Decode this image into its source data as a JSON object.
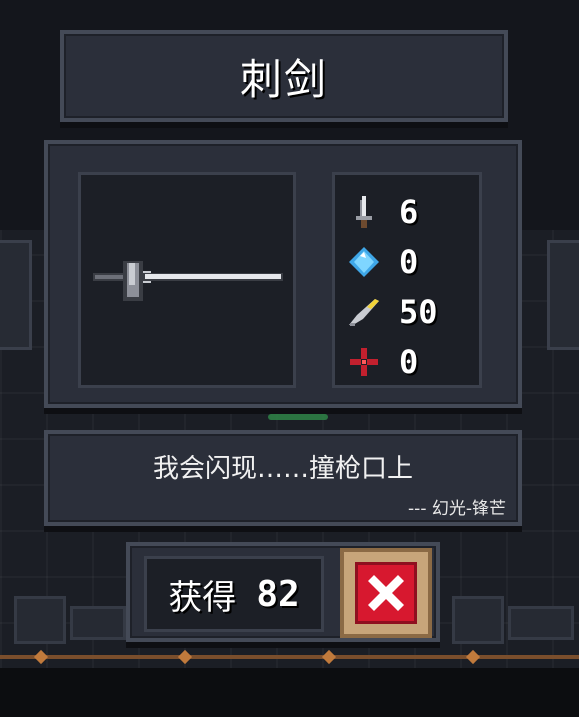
{
  "weapon": {
    "name": "刺剑",
    "icon": "rapier-icon"
  },
  "stats": [
    {
      "icon": "sword-damage-icon",
      "value": "6"
    },
    {
      "icon": "energy-crystal-icon",
      "value": "0"
    },
    {
      "icon": "critical-feather-icon",
      "value": "50"
    },
    {
      "icon": "accuracy-crosshair-icon",
      "value": "0"
    }
  ],
  "description": {
    "quote": "我会闪现……撞枪口上",
    "author": "--- 幻光-锋芒"
  },
  "reward": {
    "label": "获得",
    "amount": "82"
  },
  "close_button": {
    "icon": "close-x-icon"
  },
  "colors": {
    "panel": "#2b2f3a",
    "panel_border": "#444a57",
    "close_red": "#d7182f",
    "close_frame": "#c7a57a"
  }
}
